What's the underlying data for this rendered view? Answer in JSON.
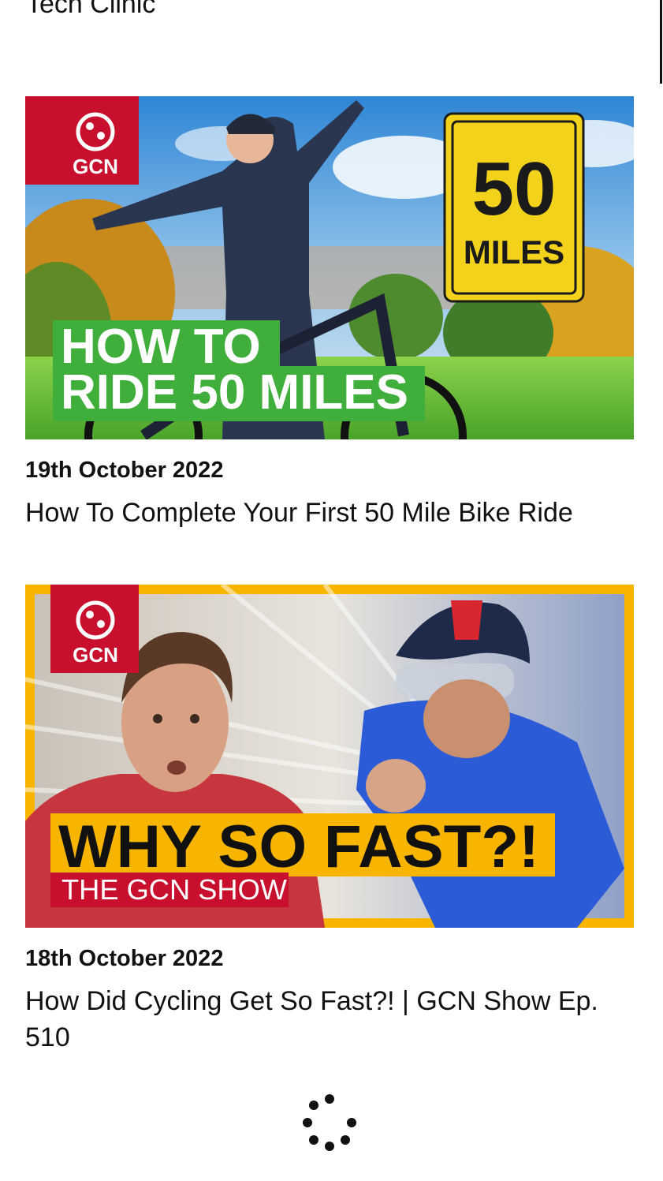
{
  "previous_item": {
    "title_tail": "Tech Clinic"
  },
  "videos": [
    {
      "date": "19th October 2022",
      "title": "How To Complete Your First 50 Mile Bike Ride",
      "thumbnail": {
        "brand": "GCN",
        "headline_line1": "HOW TO",
        "headline_line2": "RIDE 50 MILES",
        "sign_number": "50",
        "sign_unit": "MILES"
      }
    },
    {
      "date": "18th October 2022",
      "title": "How Did Cycling Get So Fast?! | GCN Show Ep. 510",
      "thumbnail": {
        "brand": "GCN",
        "headline": "WHY SO FAST?!",
        "subheadline": "THE GCN SHOW"
      }
    }
  ],
  "colors": {
    "gcn_red": "#c8102e",
    "sign_yellow": "#f2d21b",
    "headline_green": "#3fae3b",
    "frame_yellow": "#f7b500"
  },
  "loading": {
    "icon": "loading-spinner-icon"
  }
}
